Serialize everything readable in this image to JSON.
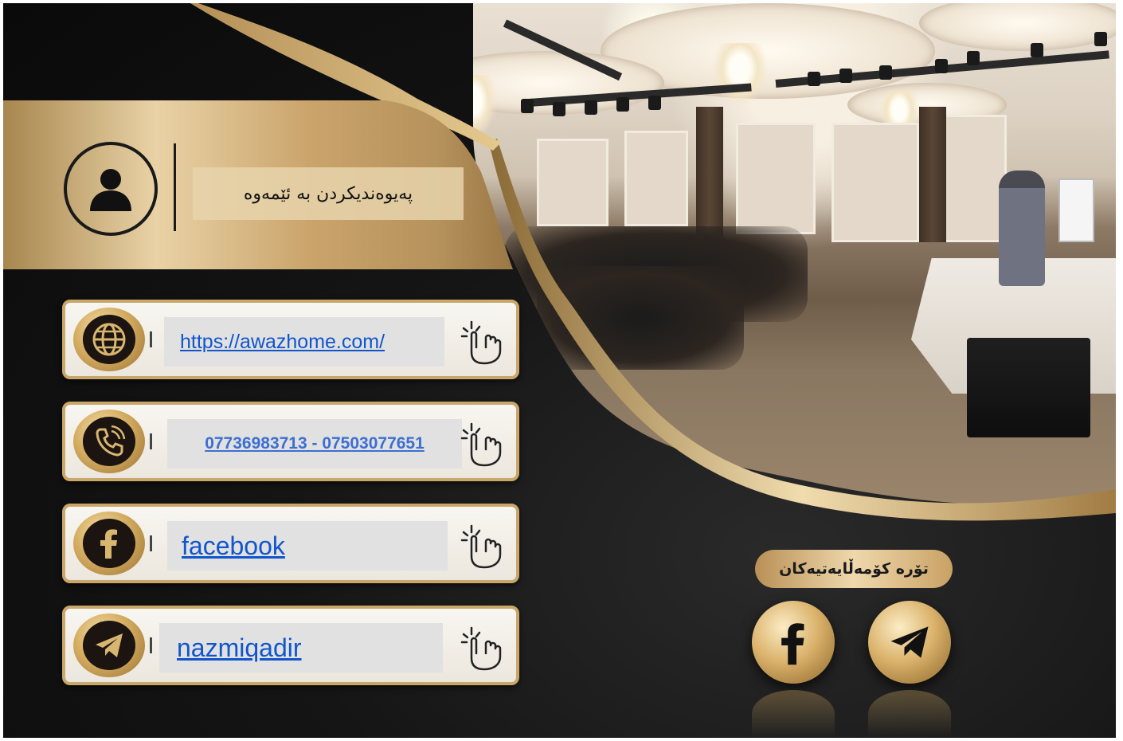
{
  "header": {
    "title": "پەیوەندیکردن بە ئێمەوە"
  },
  "contacts": [
    {
      "type": "website",
      "icon": "globe-icon",
      "label": "https://awazhome.com/"
    },
    {
      "type": "phone",
      "icon": "phone-icon",
      "label": "07736983713 - 07503077651"
    },
    {
      "type": "facebook",
      "icon": "facebook-icon",
      "label": "facebook"
    },
    {
      "type": "telegram",
      "icon": "telegram-icon",
      "label": "nazmiqadir"
    }
  ],
  "social": {
    "label": "تۆرە کۆمەڵایەتیەکان",
    "icons": [
      "facebook-icon",
      "telegram-icon"
    ]
  },
  "colors": {
    "gold": "#c9a669",
    "dark": "#151515",
    "link": "#1155cc"
  }
}
